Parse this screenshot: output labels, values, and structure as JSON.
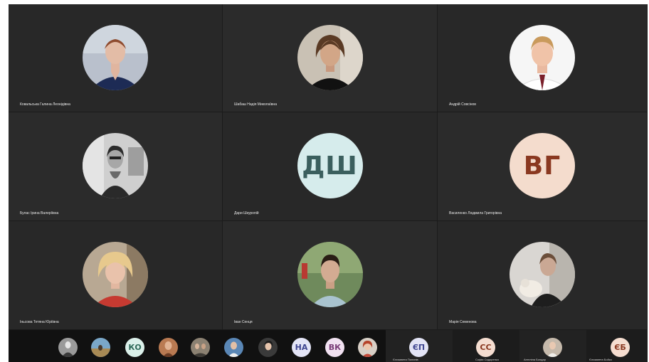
{
  "participants": [
    {
      "name": "Ковальська Галина Леонідівна",
      "photo": "woman-portrait-navy"
    },
    {
      "name": "Шабаш Надія Миколаївна",
      "photo": "woman-portrait-black-top"
    },
    {
      "name": "Андрій Совсінов",
      "photo": "young-man-portrait-white-shirt"
    },
    {
      "name": "Булас Ірина Валеріївна",
      "photo": "woman-bw-photo"
    },
    {
      "name": "Дари Шкуропій",
      "initials": "ДШ",
      "bg": "#d6ecec",
      "fg": "#3b5f5e"
    },
    {
      "name": "Василенко Людмила Григорівна",
      "initials": "ВГ",
      "bg": "#f4dccd",
      "fg": "#8a3820"
    },
    {
      "name": "Іньсова Тетяна Юріївна",
      "photo": "woman-blonde-red-top"
    },
    {
      "name": "Іван Сенця",
      "photo": "young-man-outdoors"
    },
    {
      "name": "Марія Семенова",
      "photo": "woman-with-dog"
    }
  ],
  "strip": {
    "items": [
      {
        "photo": "person-sitting"
      },
      {
        "photo": "landscape"
      },
      {
        "initials": "КО",
        "bg": "#dbf0ea",
        "fg": "#2f6a5a"
      },
      {
        "photo": "person-warm"
      },
      {
        "photo": "group-photo"
      },
      {
        "photo": "person-blue"
      },
      {
        "photo": "person-dark-hair"
      },
      {
        "initials": "НА",
        "bg": "#e3e4f6",
        "fg": "#3e4590"
      },
      {
        "initials": "ВК",
        "bg": "#f1e1f1",
        "fg": "#7a3c78"
      },
      {
        "photo": "person-red-hair"
      }
    ],
    "tiles": [
      {
        "initials": "ЄП",
        "bg": "#e3e4f6",
        "fg": "#3e4590",
        "name": "Єлизавета Пилипів"
      },
      {
        "initials": "СС",
        "bg": "#f5ddd0",
        "fg": "#8a3820",
        "name": "Софія Сидоренко"
      },
      {
        "photo": "person-tile",
        "name": "Ангеліна Бондар"
      },
      {
        "initials": "ЄБ",
        "bg": "#f5ddd0",
        "fg": "#8a3820",
        "name": "Єлизавета Бойко"
      }
    ]
  }
}
